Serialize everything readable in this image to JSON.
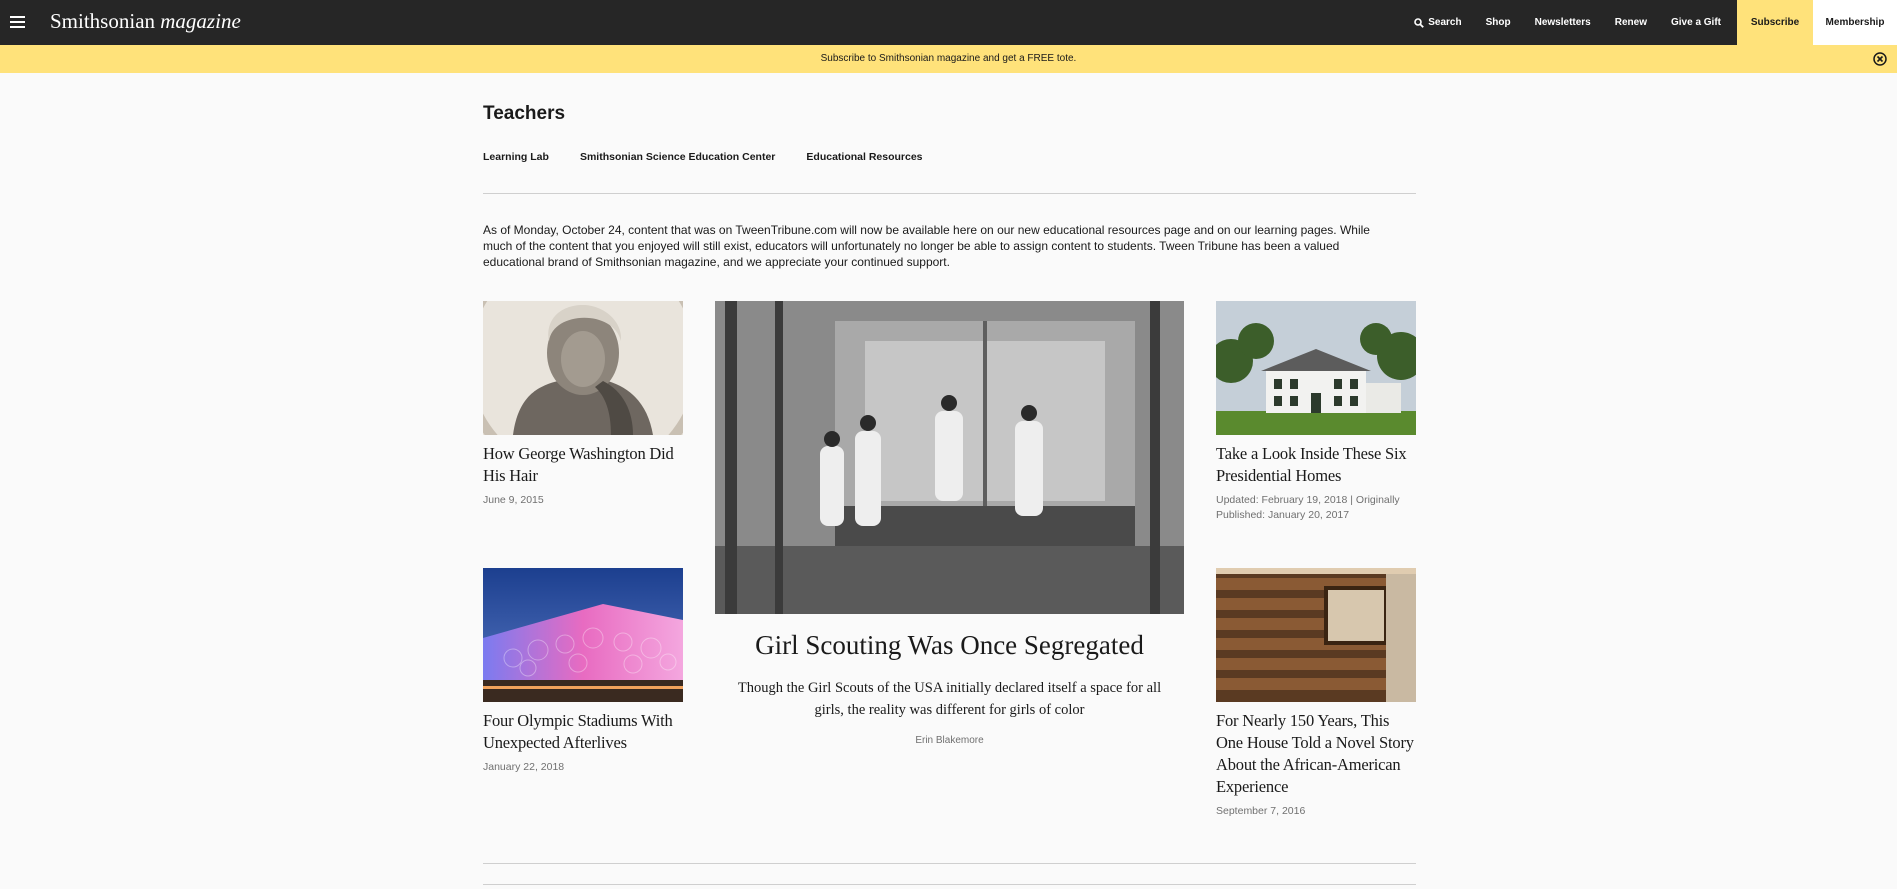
{
  "header": {
    "logo_main": "Smithsonian",
    "logo_italic": "magazine",
    "nav": {
      "search": "Search",
      "shop": "Shop",
      "newsletters": "Newsletters",
      "renew": "Renew",
      "give_gift": "Give a Gift",
      "subscribe": "Subscribe",
      "membership": "Membership"
    },
    "icons": {
      "menu": "hamburger-icon",
      "search": "search-icon",
      "close": "close-circle-icon"
    }
  },
  "promo": {
    "text": "Subscribe to Smithsonian magazine and get a FREE tote."
  },
  "section": {
    "title": "Teachers",
    "subnav": [
      "Learning Lab",
      "Smithsonian Science Education Center",
      "Educational Resources"
    ]
  },
  "intro": "As of Monday, October 24, content that was on TweenTribune.com will now be available here on our new educational resources page and on our learning pages. While much of the content that you enjoyed will still exist, educators will unfortunately no longer be able to assign content to students. Tween Tribune has been a valued educational brand of Smithsonian magazine, and we appreciate your continued support.",
  "articles": [
    {
      "title": "How George Washington Did His Hair",
      "date": "June 9, 2015"
    },
    {
      "title": "Four Olympic Stadiums With Unexpected Afterlives",
      "date": "January 22, 2018"
    },
    {
      "title": "Take a Look Inside These Six Presidential Homes",
      "date": "Updated: February 19, 2018 | Originally Published: January 20, 2017"
    },
    {
      "title": "For Nearly 150 Years, This One House Told a Novel Story About the African-American Experience",
      "date": "September 7, 2016"
    }
  ],
  "feature": {
    "title": "Girl Scouting Was Once Segregated",
    "dek": "Though the Girl Scouts of the USA initially declared itself a space for all girls, the reality was different for girls of color",
    "author": "Erin Blakemore"
  },
  "colors": {
    "topbar": "#262626",
    "accent_yellow": "#ffe27a",
    "text": "#1a1a1a",
    "muted": "#707070"
  }
}
